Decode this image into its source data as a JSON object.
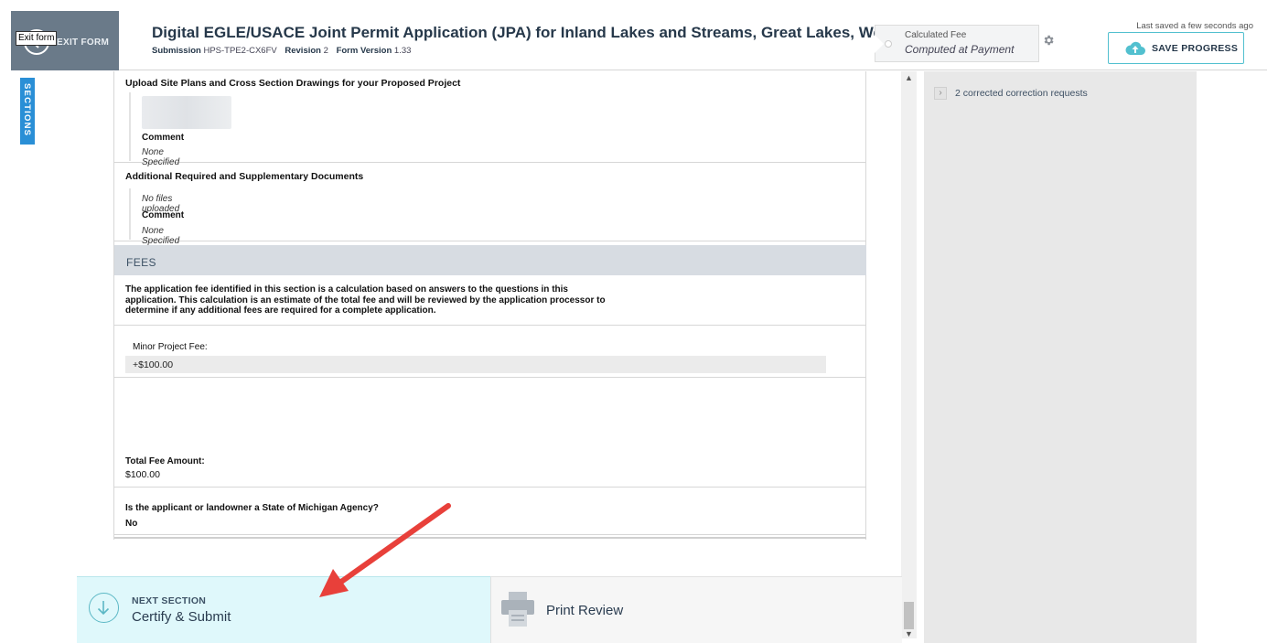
{
  "header": {
    "exit_label": "EXIT FORM",
    "exit_tooltip": "Exit form",
    "title": "Digital EGLE/USACE Joint Permit Application (JPA) for Inland Lakes and Streams, Great Lakes, Wetlan...",
    "submission_label": "Submission",
    "submission_id": "HPS-TPE2-CX6FV",
    "revision_label": "Revision",
    "revision_value": "2",
    "form_version_label": "Form Version",
    "form_version_value": "1.33",
    "fee_label": "Calculated Fee",
    "fee_value": "Computed at Payment",
    "last_saved": "Last saved a few seconds ago",
    "save_label": "SAVE PROGRESS"
  },
  "sidebar": {
    "sections_tab": "SECTIONS"
  },
  "documents": {
    "site_plans_title": "Upload Site Plans and Cross Section Drawings for your Proposed Project",
    "site_plans_comment_label": "Comment",
    "site_plans_comment_value": "None Specified",
    "additional_title": "Additional Required and Supplementary Documents",
    "additional_files": "No files uploaded",
    "additional_comment_label": "Comment",
    "additional_comment_value": "None Specified"
  },
  "fees": {
    "header": "FEES",
    "description": "The application fee identified in this section is a calculation based on answers to the questions in this application. This calculation is an estimate of the total fee and will be reviewed by the application processor to determine if any additional fees are required for a complete application.",
    "minor_label": "Minor Project Fee:",
    "minor_value": "+$100.00",
    "total_label": "Total Fee Amount:",
    "total_value": "$100.00",
    "question_label": "Is the applicant or landowner a State of Michigan Agency?",
    "question_value": "No"
  },
  "right_panel": {
    "corrections_text": "2 corrected correction requests"
  },
  "footer": {
    "next_kicker": "NEXT SECTION",
    "next_title": "Certify & Submit",
    "print_label": "Print Review"
  },
  "colors": {
    "accent": "#52c0cf",
    "sections_tab": "#2a8fd6",
    "header_dark": "#6a7a89",
    "annotation_arrow": "#e8403a"
  }
}
